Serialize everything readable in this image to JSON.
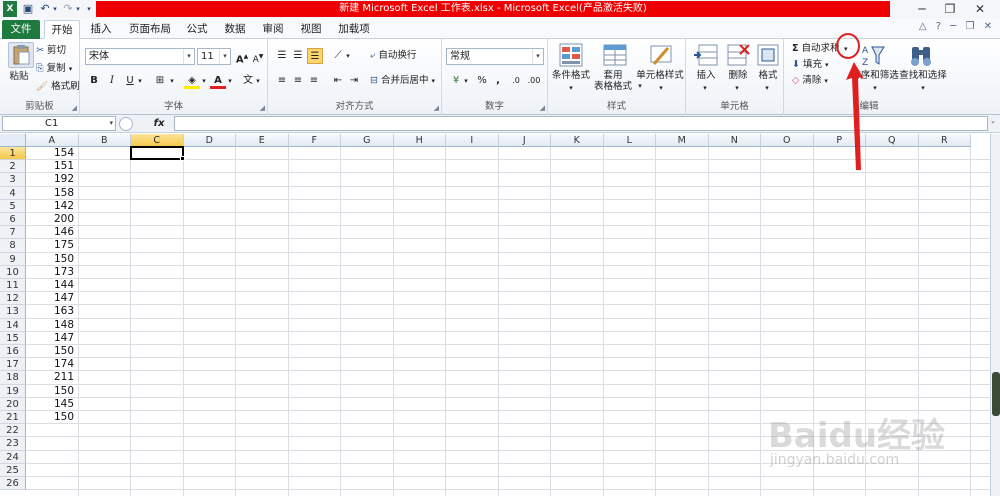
{
  "title_bar": {
    "title": "新建 Microsoft Excel 工作表.xlsx  -  Microsoft Excel(产品激活失败)",
    "window_controls": [
      "minimize-icon",
      "restore-icon",
      "close-icon"
    ]
  },
  "tabs": [
    {
      "label": "文件"
    },
    {
      "label": "开始"
    },
    {
      "label": "插入"
    },
    {
      "label": "页面布局"
    },
    {
      "label": "公式"
    },
    {
      "label": "数据"
    },
    {
      "label": "审阅"
    },
    {
      "label": "视图"
    },
    {
      "label": "加载项"
    }
  ],
  "ribbon": {
    "clipboard": {
      "paste": "粘贴",
      "cut": "剪切",
      "copy": "复制",
      "format_painter": "格式刷",
      "label": "剪贴板"
    },
    "font": {
      "family": "宋体",
      "size": "11",
      "bold": "B",
      "italic": "I",
      "underline": "U",
      "label": "字体"
    },
    "alignment": {
      "wrap_text": "自动换行",
      "merge_center": "合并后居中",
      "label": "对齐方式"
    },
    "number": {
      "format": "常规",
      "percent": "%",
      "comma": ",",
      "label": "数字"
    },
    "styles": {
      "conditional": "条件格式",
      "table_line1": "套用",
      "table_line2": "表格格式",
      "cell_styles": "单元格样式",
      "label": "样式"
    },
    "cells": {
      "insert": "插入",
      "delete": "删除",
      "format": "格式",
      "label": "单元格"
    },
    "editing": {
      "autosum": "自动求和",
      "fill": "填充",
      "clear": "清除",
      "sort_filter": "排序和筛选",
      "find_select": "查找和选择",
      "label": "编辑"
    }
  },
  "formula_bar": {
    "name_box": "C1",
    "fx": "fx",
    "formula": ""
  },
  "sheet": {
    "columns": [
      "A",
      "B",
      "C",
      "D",
      "E",
      "F",
      "G",
      "H",
      "I",
      "J",
      "K",
      "L",
      "M",
      "N",
      "O",
      "P",
      "Q",
      "R"
    ],
    "selected_column": "C",
    "selected_row": 1,
    "rows": [
      "1",
      "2",
      "3",
      "4",
      "5",
      "6",
      "7",
      "8",
      "9",
      "10",
      "11",
      "12",
      "13",
      "14",
      "15",
      "16",
      "17",
      "18",
      "19",
      "20",
      "21",
      "22",
      "23",
      "24",
      "25",
      "26"
    ],
    "column_a_values": [
      "154",
      "151",
      "192",
      "158",
      "142",
      "200",
      "146",
      "175",
      "150",
      "173",
      "144",
      "147",
      "163",
      "148",
      "147",
      "150",
      "174",
      "211",
      "150",
      "145",
      "150"
    ]
  },
  "watermark": {
    "brand": "Baidu经验",
    "url": "jingyan.baidu.com"
  },
  "colors": {
    "title_red": "#ee0000",
    "file_tab": "#1f7a3d",
    "annotation_red": "#e21f1f",
    "selected_header": "#f5c94b"
  }
}
